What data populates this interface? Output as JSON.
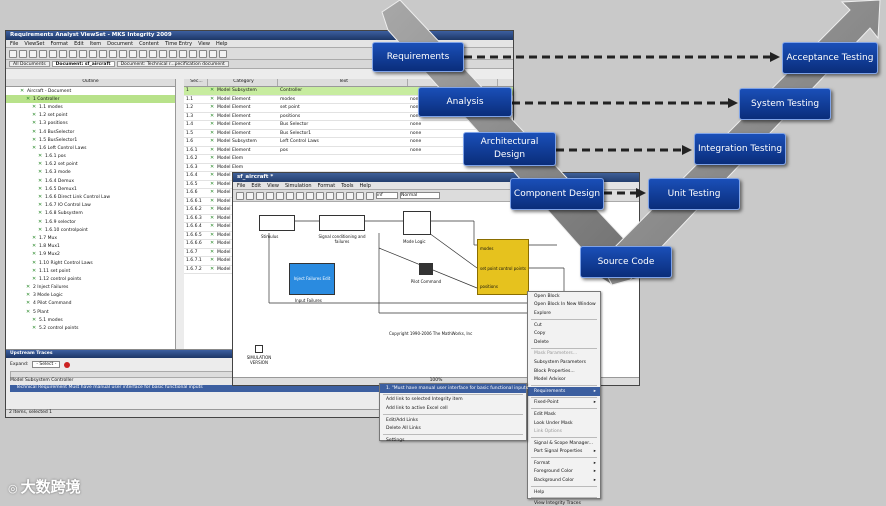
{
  "main_window": {
    "title": "Requirements Analyst ViewSet - MKS Integrity 2009",
    "menu": [
      "File",
      "ViewSet",
      "Format",
      "Edit",
      "Item",
      "Document",
      "Content",
      "Time Entry",
      "View",
      "Help"
    ],
    "tabs": [
      "All Documents",
      "Document: sf_aircraft",
      "Document: Technical r...pecification document"
    ],
    "outline_header": "Outline",
    "outline": [
      {
        "label": "Aircraft - Document",
        "indent": 0
      },
      {
        "label": "1 Controller",
        "indent": 1,
        "sel": true
      },
      {
        "label": "1.1 modes",
        "indent": 2
      },
      {
        "label": "1.2 set point",
        "indent": 2
      },
      {
        "label": "1.3 positions",
        "indent": 2
      },
      {
        "label": "1.4 BusSelector",
        "indent": 2
      },
      {
        "label": "1.5 BusSelector1",
        "indent": 2
      },
      {
        "label": "1.6 Left Control Laws",
        "indent": 2
      },
      {
        "label": "1.6.1 pos",
        "indent": 3
      },
      {
        "label": "1.6.2 set point",
        "indent": 3
      },
      {
        "label": "1.6.3 mode",
        "indent": 3
      },
      {
        "label": "1.6.4 Demux",
        "indent": 3
      },
      {
        "label": "1.6.5 Demux1",
        "indent": 3
      },
      {
        "label": "1.6.6 Direct Link Control Law",
        "indent": 3
      },
      {
        "label": "1.6.7 IO Control Law",
        "indent": 3
      },
      {
        "label": "1.6.8 Subsystem",
        "indent": 3
      },
      {
        "label": "1.6.9 selector",
        "indent": 3
      },
      {
        "label": "1.6.10 controlpoint",
        "indent": 3
      },
      {
        "label": "1.7 Mux",
        "indent": 2
      },
      {
        "label": "1.8 Mux1",
        "indent": 2
      },
      {
        "label": "1.9 Mux2",
        "indent": 2
      },
      {
        "label": "1.10 Right Control Laws",
        "indent": 2
      },
      {
        "label": "1.11 set point",
        "indent": 2
      },
      {
        "label": "1.12 control points",
        "indent": 2
      },
      {
        "label": "2 Inject Failures",
        "indent": 1
      },
      {
        "label": "3 Mode Logic",
        "indent": 1
      },
      {
        "label": "4 Pilot Command",
        "indent": 1
      },
      {
        "label": "5 Plant",
        "indent": 1
      },
      {
        "label": "5.1 modes",
        "indent": 2
      },
      {
        "label": "5.2 control points",
        "indent": 2
      }
    ],
    "grid_headers": [
      "Sec...",
      "Category",
      "Text",
      ""
    ],
    "grid": [
      {
        "sec": "1",
        "cat": "Model Subsystem",
        "text": "Controller",
        "st": "",
        "sel": true
      },
      {
        "sec": "1.1",
        "cat": "Model Element",
        "text": "modes",
        "st": "none"
      },
      {
        "sec": "1.2",
        "cat": "Model Element",
        "text": "set point",
        "st": "none"
      },
      {
        "sec": "1.3",
        "cat": "Model Element",
        "text": "positions",
        "st": "none"
      },
      {
        "sec": "1.4",
        "cat": "Model Element",
        "text": "Bus Selector",
        "st": "none"
      },
      {
        "sec": "1.5",
        "cat": "Model Element",
        "text": "Bus Selector1",
        "st": "none"
      },
      {
        "sec": "1.6",
        "cat": "Model Subsystem",
        "text": "Left Control Laws",
        "st": "none"
      },
      {
        "sec": "1.6.1",
        "cat": "Model Element",
        "text": "pos",
        "st": "none"
      },
      {
        "sec": "1.6.2",
        "cat": "Model Elem",
        "text": "",
        "st": ""
      },
      {
        "sec": "1.6.3",
        "cat": "Model Elem",
        "text": "",
        "st": ""
      },
      {
        "sec": "1.6.4",
        "cat": "Model Elem",
        "text": "",
        "st": ""
      },
      {
        "sec": "1.6.5",
        "cat": "Model Elem",
        "text": "",
        "st": ""
      },
      {
        "sec": "1.6.6",
        "cat": "Model Ele",
        "text": "",
        "st": ""
      },
      {
        "sec": "1.6.6.1",
        "cat": "Model Ele",
        "text": "",
        "st": ""
      },
      {
        "sec": "1.6.6.2",
        "cat": "Model Ele",
        "text": "",
        "st": ""
      },
      {
        "sec": "1.6.6.3",
        "cat": "Model Ele",
        "text": "",
        "st": ""
      },
      {
        "sec": "1.6.6.4",
        "cat": "Model Ele",
        "text": "",
        "st": ""
      },
      {
        "sec": "1.6.6.5",
        "cat": "Model Ele",
        "text": "",
        "st": ""
      },
      {
        "sec": "1.6.6.6",
        "cat": "Model Ele",
        "text": "",
        "st": ""
      },
      {
        "sec": "1.6.7",
        "cat": "Model Ele",
        "text": "",
        "st": ""
      },
      {
        "sec": "1.6.7.1",
        "cat": "Model Ele",
        "text": "",
        "st": ""
      },
      {
        "sec": "1.6.7.2",
        "cat": "Model Ele",
        "text": "",
        "st": ""
      }
    ],
    "trace_title": "Upstream Traces",
    "expand_label": "Expand:",
    "expand_value": "- Select -",
    "structure_header": "Structure",
    "trace_rows": [
      "Model Subsystem Controller",
      "Technical Requirement Must have manual user interface for basic functional inputs"
    ],
    "status": "2 Items, selected 1"
  },
  "simulink": {
    "title": "sf_aircraft *",
    "menu": [
      "File",
      "Edit",
      "View",
      "Simulation",
      "Format",
      "Tools",
      "Help"
    ],
    "mode": "Normal",
    "stop_time": "inf",
    "blocks": {
      "stimulus": "Stimulus",
      "signal": "Signal conditioning and failures",
      "mode_logic": "Mode Logic",
      "controller": "Controller",
      "inject": "Inject Failures Edit",
      "injected": "Input Failures",
      "pilot": "Pilot Command",
      "ports": [
        "modes",
        "set point",
        "positions",
        "control points"
      ]
    },
    "copyright": "Copyright 1990-2006 The MathWorks, Inc",
    "sim_block": "SIMULATION VERSION",
    "zoom": "100%"
  },
  "context_menu": {
    "items": [
      "Open Block",
      "Open Block In New Window",
      "Explore",
      "-",
      "Cut",
      "Copy",
      "Delete",
      "-",
      "Mask Parameters...",
      "Subsystem Parameters",
      "Block Properties...",
      "Model Advisor",
      "-",
      "Requirements",
      "-",
      "Fixed-Point",
      "-",
      "Edit Mask",
      "Look Under Mask",
      "Link Options",
      "-",
      "Signal & Scope Manager...",
      "Port Signal Properties",
      "-",
      "Format",
      "Foreground Color",
      "Background Color",
      "-",
      "Help",
      "-",
      "View Integrity Traces"
    ]
  },
  "req_submenu": [
    "1. \"Must have manual user interface for basic functional inputs\"",
    "Add link to selected Integrity item",
    "Add link to active Excel cell",
    "Edit/Add Links",
    "Delete All Links",
    "Settings"
  ],
  "vmodel": {
    "left": [
      "Requirements",
      "Analysis",
      "Architectural Design",
      "Component Design"
    ],
    "bottom": "Source Code",
    "right": [
      "Acceptance Testing",
      "System Testing",
      "Integration Testing",
      "Unit Testing"
    ],
    "arrow_color": "#8a8a8a",
    "box_color": "#0f3d9c"
  },
  "watermark": "大数跨境"
}
